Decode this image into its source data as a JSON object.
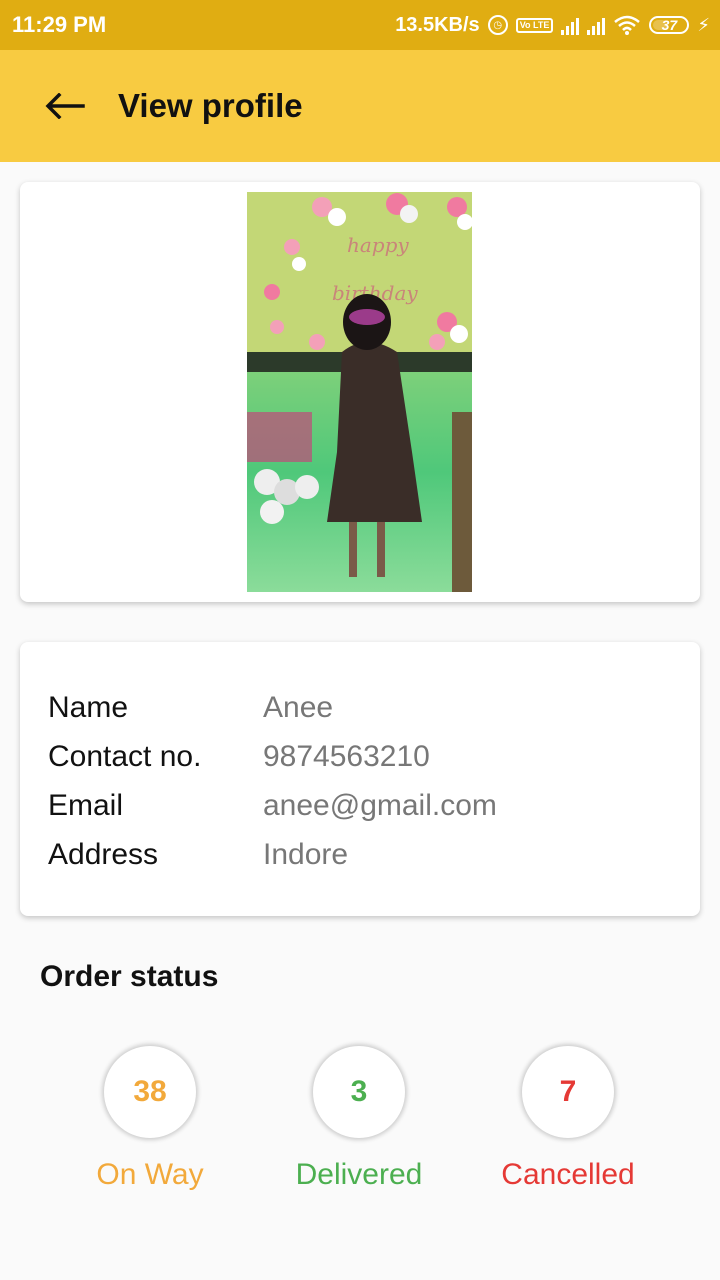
{
  "status_bar": {
    "time": "11:29 PM",
    "network_speed": "13.5KB/s",
    "volte_label": "Vo LTE",
    "battery_level": "37",
    "icons": [
      "alarm-icon",
      "volte-icon",
      "signal-icon",
      "signal-icon",
      "wifi-icon",
      "battery-icon",
      "charging-bolt-icon"
    ]
  },
  "app_bar": {
    "title": "View profile",
    "back_icon": "arrow-left-icon",
    "background": "#f8cb41"
  },
  "profile_photo": {
    "banner_text": "happy birthday"
  },
  "profile": {
    "rows": [
      {
        "label": "Name",
        "value": "Anee"
      },
      {
        "label": "Contact no.",
        "value": "9874563210"
      },
      {
        "label": "Email",
        "value": "anee@gmail.com"
      },
      {
        "label": "Address",
        "value": "Indore"
      }
    ]
  },
  "order_status": {
    "title": "Order status",
    "stats": [
      {
        "count": "38",
        "label": "On Way",
        "color": "#f2a93b"
      },
      {
        "count": "3",
        "label": "Delivered",
        "color": "#4caf50"
      },
      {
        "count": "7",
        "label": "Cancelled",
        "color": "#e53935"
      }
    ]
  }
}
